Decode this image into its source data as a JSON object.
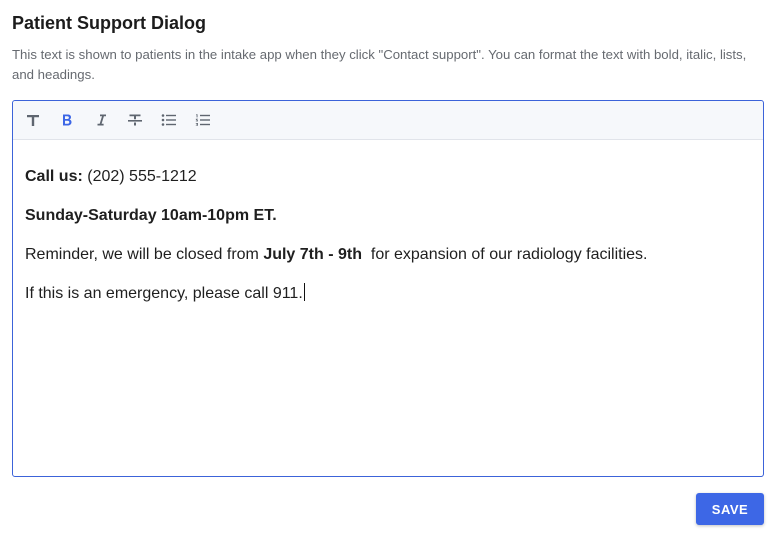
{
  "page": {
    "title": "Patient Support Dialog",
    "description": "This text is shown to patients in the intake app when they click \"Contact support\". You can format the text with bold, italic, lists, and headings."
  },
  "toolbar": {
    "buttons": [
      {
        "name": "text-style",
        "icon": "text-icon"
      },
      {
        "name": "bold",
        "icon": "bold-icon",
        "active": true
      },
      {
        "name": "italic",
        "icon": "italic-icon"
      },
      {
        "name": "strikethrough",
        "icon": "strikethrough-icon"
      },
      {
        "name": "bullet-list",
        "icon": "bullet-list-icon"
      },
      {
        "name": "numbered-list",
        "icon": "numbered-list-icon"
      }
    ],
    "colors": {
      "default": "#5f6670",
      "active": "#3d67e6"
    }
  },
  "editor": {
    "lines": [
      {
        "bold": "Call us:",
        "text": " (202) 555-1212"
      },
      {
        "bold": "Sunday-Saturday 10am-10pm ET."
      },
      {
        "prefix": "Reminder, we will be closed from ",
        "bold": "July 7th - 9th",
        "suffix": "  for expansion of our radiology facilities."
      },
      {
        "text": "If this is an emergency, please call 911."
      }
    ]
  },
  "actions": {
    "save_label": "SAVE"
  },
  "colors": {
    "accent": "#3d67e6",
    "border": "#3c63d9",
    "muted_text": "#666a70"
  }
}
